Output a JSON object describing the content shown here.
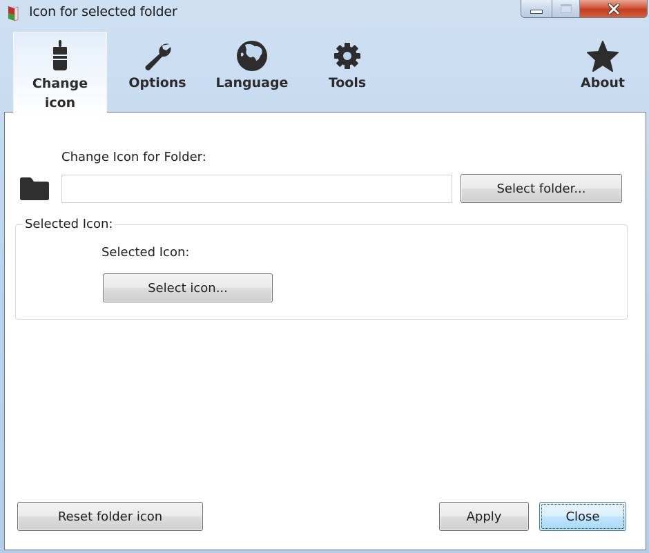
{
  "window": {
    "title": "Icon for selected folder",
    "controls": {
      "minimize": "minimize",
      "maximize": "maximize",
      "close": "close"
    }
  },
  "toolbar": {
    "tabs": [
      {
        "label": "Change\nicon",
        "icon": "paintbrush-icon",
        "active": true
      },
      {
        "label": "Options",
        "icon": "wrench-icon",
        "active": false
      },
      {
        "label": "Language",
        "icon": "globe-icon",
        "active": false
      },
      {
        "label": "Tools",
        "icon": "gear-icon",
        "active": false
      },
      {
        "label": "About",
        "icon": "star-icon",
        "active": false
      }
    ]
  },
  "main": {
    "folder_label": "Change Icon for Folder:",
    "folder_input": {
      "value": "",
      "placeholder": ""
    },
    "select_folder_button": "Select folder...",
    "group_title": "Selected Icon:",
    "selected_icon_label": "Selected Icon:",
    "select_icon_button": "Select icon..."
  },
  "footer": {
    "reset_button": "Reset folder icon",
    "apply_button": "Apply",
    "close_button": "Close"
  },
  "colors": {
    "titlebar_bg": "#c4d9f0",
    "close_button": "#c9472a",
    "focus_button": "#bee6fd"
  }
}
